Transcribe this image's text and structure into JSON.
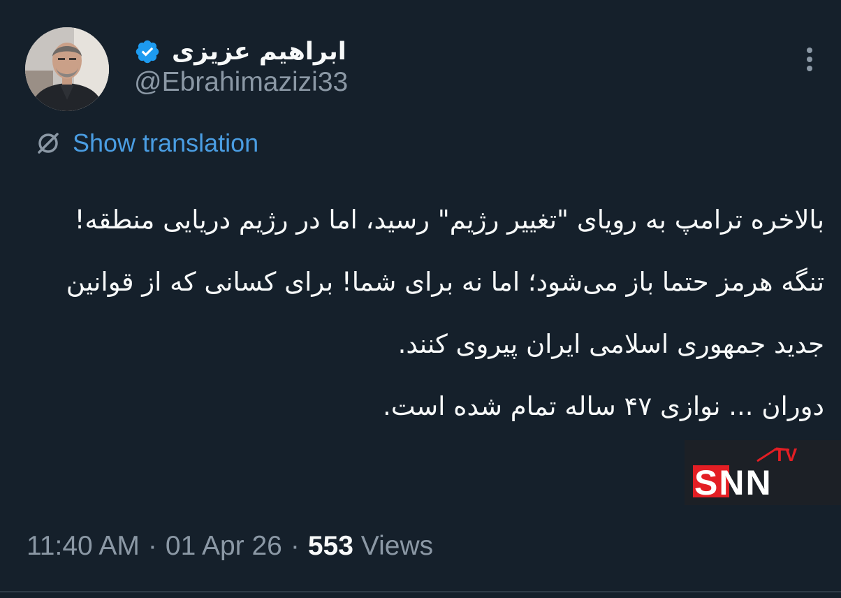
{
  "author": {
    "display_name": "ابراهیم عزیزی",
    "handle": "@Ebrahimazizi33",
    "verified": true
  },
  "translate": {
    "label": "Show translation"
  },
  "tweet": {
    "paragraphs": [
      "بالاخره ترامپ به رویای \"تغییر رژیم\" رسید، اما در رژیم دریایی منطقه!",
      "تنگه هرمز حتما باز می‌شود؛ اما نه برای شما! برای کسانی که از قوانین جدید جمهوری اسلامی ایران پیروی کنند.",
      "دوران ... نوازی ۴۷ ساله تمام شده است."
    ]
  },
  "meta": {
    "time": "11:40 AM",
    "separator": "·",
    "date": "01 Apr 26",
    "views_count": "553",
    "views_label": "Views"
  },
  "watermark": {
    "brand": "SNN",
    "sub": "TV"
  },
  "colors": {
    "background": "#15202b",
    "text_primary": "#f7f9f9",
    "text_secondary": "#8b98a5",
    "link": "#4a9de2",
    "verified": "#1d9bf0",
    "watermark_red": "#e31e24"
  },
  "icons": {
    "verified": "verified-badge-icon",
    "more": "more-options-icon",
    "translate": "translate-icon"
  }
}
